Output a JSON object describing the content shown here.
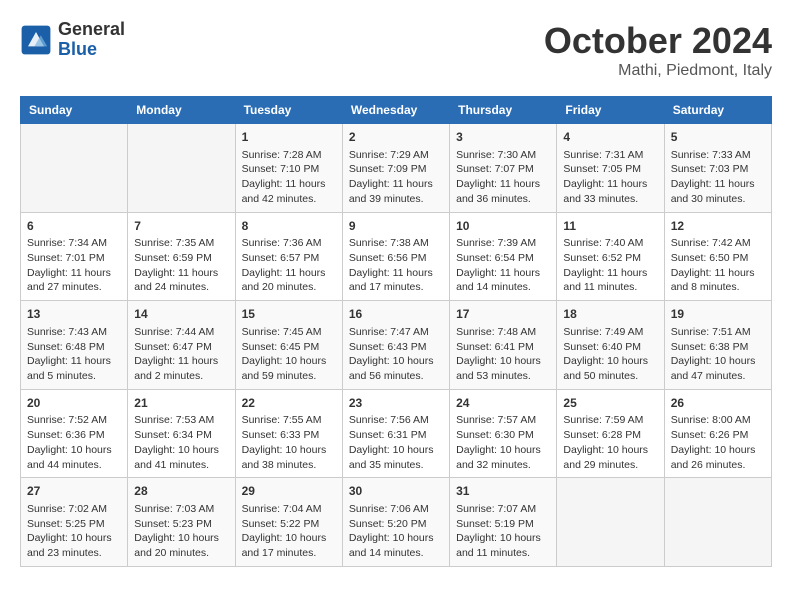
{
  "header": {
    "logo_line1": "General",
    "logo_line2": "Blue",
    "month": "October 2024",
    "location": "Mathi, Piedmont, Italy"
  },
  "days_of_week": [
    "Sunday",
    "Monday",
    "Tuesday",
    "Wednesday",
    "Thursday",
    "Friday",
    "Saturday"
  ],
  "weeks": [
    [
      {
        "day": "",
        "info": ""
      },
      {
        "day": "",
        "info": ""
      },
      {
        "day": "1",
        "sunrise": "7:28 AM",
        "sunset": "7:10 PM",
        "daylight": "11 hours and 42 minutes."
      },
      {
        "day": "2",
        "sunrise": "7:29 AM",
        "sunset": "7:09 PM",
        "daylight": "11 hours and 39 minutes."
      },
      {
        "day": "3",
        "sunrise": "7:30 AM",
        "sunset": "7:07 PM",
        "daylight": "11 hours and 36 minutes."
      },
      {
        "day": "4",
        "sunrise": "7:31 AM",
        "sunset": "7:05 PM",
        "daylight": "11 hours and 33 minutes."
      },
      {
        "day": "5",
        "sunrise": "7:33 AM",
        "sunset": "7:03 PM",
        "daylight": "11 hours and 30 minutes."
      }
    ],
    [
      {
        "day": "6",
        "sunrise": "7:34 AM",
        "sunset": "7:01 PM",
        "daylight": "11 hours and 27 minutes."
      },
      {
        "day": "7",
        "sunrise": "7:35 AM",
        "sunset": "6:59 PM",
        "daylight": "11 hours and 24 minutes."
      },
      {
        "day": "8",
        "sunrise": "7:36 AM",
        "sunset": "6:57 PM",
        "daylight": "11 hours and 20 minutes."
      },
      {
        "day": "9",
        "sunrise": "7:38 AM",
        "sunset": "6:56 PM",
        "daylight": "11 hours and 17 minutes."
      },
      {
        "day": "10",
        "sunrise": "7:39 AM",
        "sunset": "6:54 PM",
        "daylight": "11 hours and 14 minutes."
      },
      {
        "day": "11",
        "sunrise": "7:40 AM",
        "sunset": "6:52 PM",
        "daylight": "11 hours and 11 minutes."
      },
      {
        "day": "12",
        "sunrise": "7:42 AM",
        "sunset": "6:50 PM",
        "daylight": "11 hours and 8 minutes."
      }
    ],
    [
      {
        "day": "13",
        "sunrise": "7:43 AM",
        "sunset": "6:48 PM",
        "daylight": "11 hours and 5 minutes."
      },
      {
        "day": "14",
        "sunrise": "7:44 AM",
        "sunset": "6:47 PM",
        "daylight": "11 hours and 2 minutes."
      },
      {
        "day": "15",
        "sunrise": "7:45 AM",
        "sunset": "6:45 PM",
        "daylight": "10 hours and 59 minutes."
      },
      {
        "day": "16",
        "sunrise": "7:47 AM",
        "sunset": "6:43 PM",
        "daylight": "10 hours and 56 minutes."
      },
      {
        "day": "17",
        "sunrise": "7:48 AM",
        "sunset": "6:41 PM",
        "daylight": "10 hours and 53 minutes."
      },
      {
        "day": "18",
        "sunrise": "7:49 AM",
        "sunset": "6:40 PM",
        "daylight": "10 hours and 50 minutes."
      },
      {
        "day": "19",
        "sunrise": "7:51 AM",
        "sunset": "6:38 PM",
        "daylight": "10 hours and 47 minutes."
      }
    ],
    [
      {
        "day": "20",
        "sunrise": "7:52 AM",
        "sunset": "6:36 PM",
        "daylight": "10 hours and 44 minutes."
      },
      {
        "day": "21",
        "sunrise": "7:53 AM",
        "sunset": "6:34 PM",
        "daylight": "10 hours and 41 minutes."
      },
      {
        "day": "22",
        "sunrise": "7:55 AM",
        "sunset": "6:33 PM",
        "daylight": "10 hours and 38 minutes."
      },
      {
        "day": "23",
        "sunrise": "7:56 AM",
        "sunset": "6:31 PM",
        "daylight": "10 hours and 35 minutes."
      },
      {
        "day": "24",
        "sunrise": "7:57 AM",
        "sunset": "6:30 PM",
        "daylight": "10 hours and 32 minutes."
      },
      {
        "day": "25",
        "sunrise": "7:59 AM",
        "sunset": "6:28 PM",
        "daylight": "10 hours and 29 minutes."
      },
      {
        "day": "26",
        "sunrise": "8:00 AM",
        "sunset": "6:26 PM",
        "daylight": "10 hours and 26 minutes."
      }
    ],
    [
      {
        "day": "27",
        "sunrise": "7:02 AM",
        "sunset": "5:25 PM",
        "daylight": "10 hours and 23 minutes."
      },
      {
        "day": "28",
        "sunrise": "7:03 AM",
        "sunset": "5:23 PM",
        "daylight": "10 hours and 20 minutes."
      },
      {
        "day": "29",
        "sunrise": "7:04 AM",
        "sunset": "5:22 PM",
        "daylight": "10 hours and 17 minutes."
      },
      {
        "day": "30",
        "sunrise": "7:06 AM",
        "sunset": "5:20 PM",
        "daylight": "10 hours and 14 minutes."
      },
      {
        "day": "31",
        "sunrise": "7:07 AM",
        "sunset": "5:19 PM",
        "daylight": "10 hours and 11 minutes."
      },
      {
        "day": "",
        "info": ""
      },
      {
        "day": "",
        "info": ""
      }
    ]
  ]
}
